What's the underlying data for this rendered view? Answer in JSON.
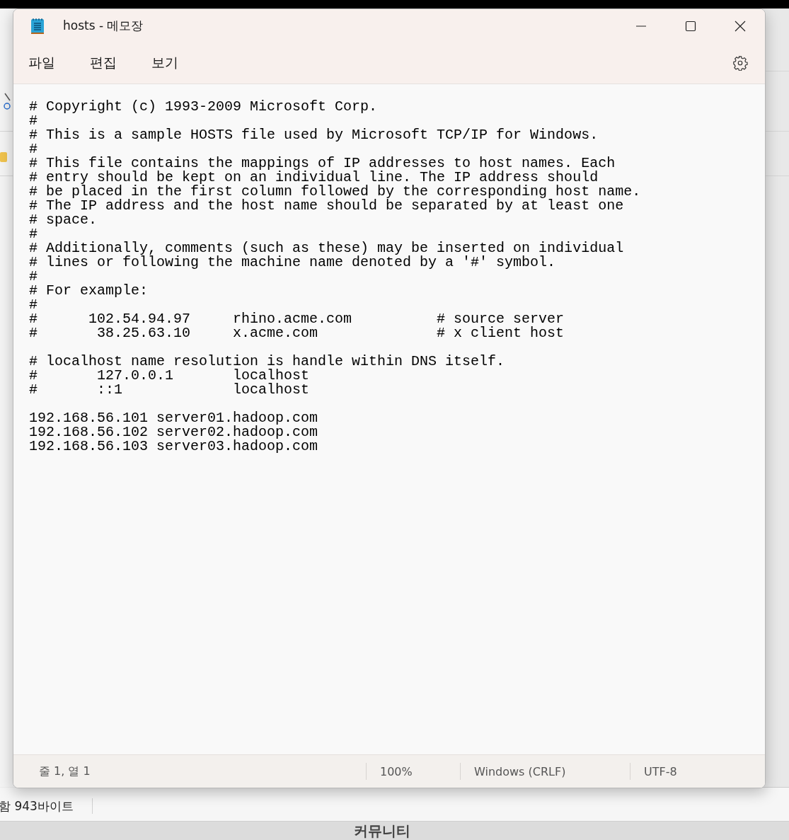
{
  "window": {
    "title": "hosts - 메모장"
  },
  "menu": [
    "파일",
    "편집",
    "보기"
  ],
  "editor": {
    "text": "# Copyright (c) 1993-2009 Microsoft Corp.\n#\n# This is a sample HOSTS file used by Microsoft TCP/IP for Windows.\n#\n# This file contains the mappings of IP addresses to host names. Each\n# entry should be kept on an individual line. The IP address should\n# be placed in the first column followed by the corresponding host name.\n# The IP address and the host name should be separated by at least one\n# space.\n#\n# Additionally, comments (such as these) may be inserted on individual\n# lines or following the machine name denoted by a '#' symbol.\n#\n# For example:\n#\n#      102.54.94.97     rhino.acme.com          # source server\n#       38.25.63.10     x.acme.com              # x client host\n\n# localhost name resolution is handle within DNS itself.\n#       127.0.0.1       localhost\n#       ::1             localhost\n\n192.168.56.101 server01.hadoop.com\n192.168.56.102 server02.hadoop.com\n192.168.56.103 server03.hadoop.com"
  },
  "status_bar": {
    "position": "줄 1, 열 1",
    "zoom": "100%",
    "line_ending": "Windows (CRLF)",
    "encoding": "UTF-8"
  },
  "background": {
    "status_text": "함 943바이트",
    "heading": "커뮤니티"
  }
}
